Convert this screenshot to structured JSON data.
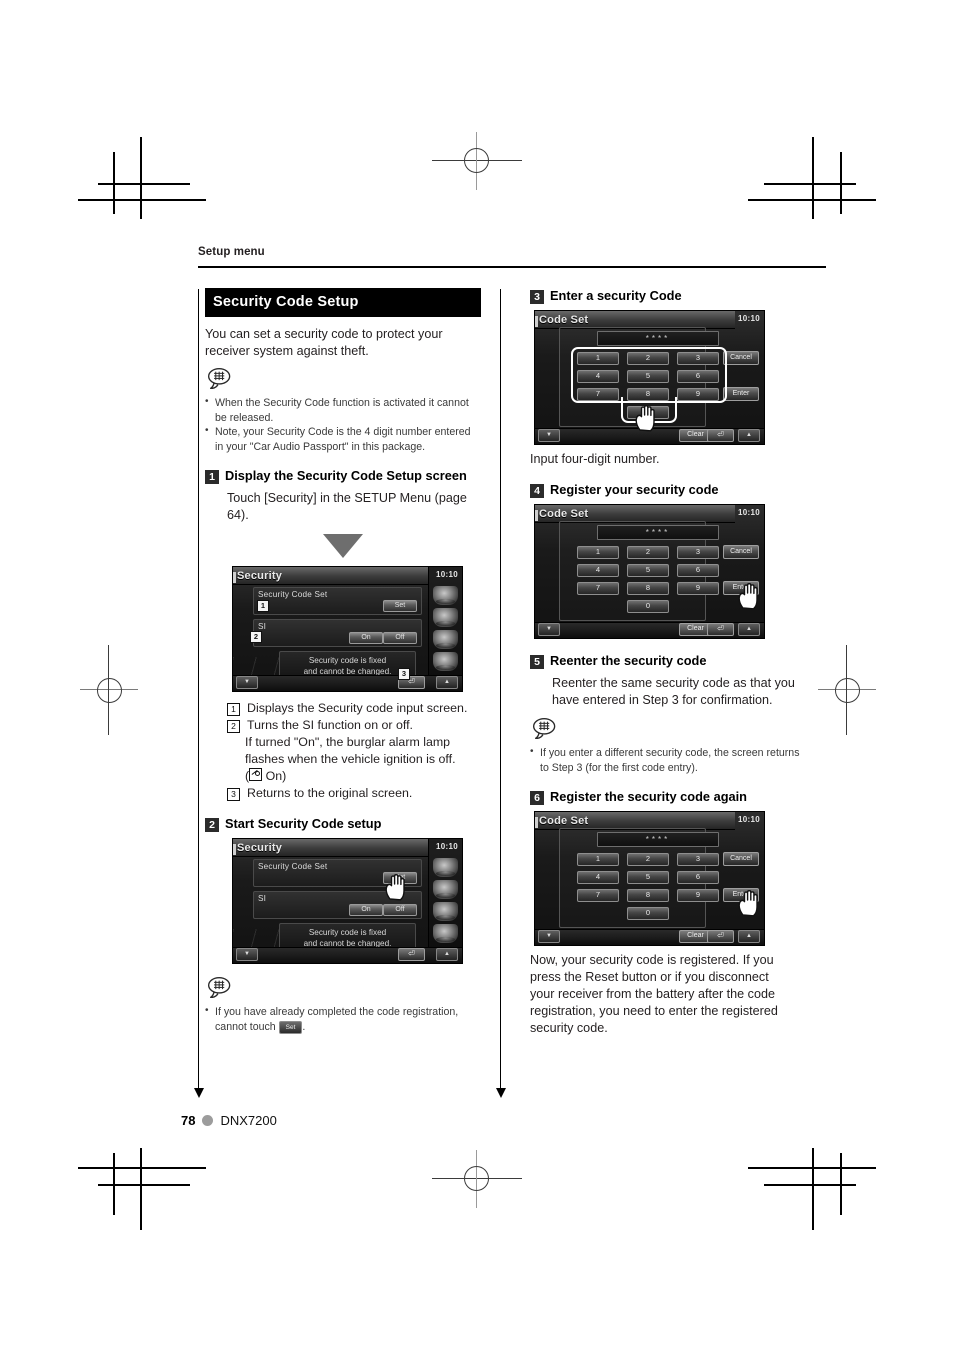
{
  "document": {
    "running_head": "Setup menu",
    "page_number": "78",
    "model": "DNX7200"
  },
  "section": {
    "title": "Security Code Setup",
    "intro": "You can set a security code to protect your receiver system against theft.",
    "note_icon": "note-bubble-icon",
    "notes": [
      "When the Security Code function is activated it cannot be released.",
      "Note, your Security Code is the 4 digit number entered in your \"Car Audio Passport\" in this package."
    ]
  },
  "steps": [
    {
      "num": "1",
      "title": "Display the Security Code Setup screen",
      "body": "Touch [Security] in the SETUP Menu (page 64)."
    },
    {
      "num": "2",
      "title": "Start Security Code setup"
    },
    {
      "num": "3",
      "title": "Enter a security Code",
      "body": "Input four-digit number."
    },
    {
      "num": "4",
      "title": "Register your security code"
    },
    {
      "num": "5",
      "title": "Reenter the security code",
      "body": "Reenter the same security code as that you have entered in Step 3 for confirmation."
    },
    {
      "num": "6",
      "title": "Register the security code again",
      "body": "Now, your security code is registered. If you press the Reset button or if you disconnect your receiver from the battery after the code registration, you need to enter the registered security code."
    }
  ],
  "callouts": [
    {
      "num": "1",
      "text": "Displays the Security code input screen."
    },
    {
      "num": "2",
      "text": "Turns the SI function on or off.",
      "cont1": "If turned \"On\", the burglar alarm lamp",
      "cont2": "flashes when the vehicle ignition is off.",
      "cont3_prefix": "(",
      "cont3_suffix": " On)"
    },
    {
      "num": "3",
      "text": "Returns to the original screen."
    }
  ],
  "notes_step2": {
    "icon": "note-bubble-icon",
    "prefix": "If you have already completed the code registration,",
    "line2_prefix": "cannot touch",
    "chip": "Set",
    "line2_suffix": "."
  },
  "notes_step5": {
    "icon": "note-bubble-icon",
    "line1": "If you enter a different security code, the screen returns",
    "line2": "to Step 3 (for the first code entry)."
  },
  "device_security": {
    "title": "Security",
    "clock": "10:10",
    "row1_label": "Security Code Set",
    "row1_button": "Set",
    "row2_label": "SI",
    "row2_on": "On",
    "row2_off": "Off",
    "info_line1": "Security code is fixed",
    "info_line2": "and cannot be changed.",
    "callout1": "1",
    "callout2": "2",
    "callout3": "3",
    "nav_left": "▼",
    "nav_right": "▲",
    "return_btn": "⏎"
  },
  "device_code": {
    "title": "Code Set",
    "clock": "10:10",
    "field_value": "****",
    "keys": [
      "1",
      "2",
      "3",
      "4",
      "5",
      "6",
      "7",
      "8",
      "9",
      "0"
    ],
    "cancel": "Cancel",
    "enter": "Enter",
    "clear": "Clear",
    "nav_left": "▼",
    "nav_right": "▲",
    "return_btn": "⏎"
  },
  "colors": {
    "section_bar_bg": "#000000",
    "section_bar_text": "#ffffff",
    "step_badge_bg": "#2b2b2b",
    "body_text": "#231f20",
    "note_text": "#3a3a3a",
    "triangle": "#6e6e6e",
    "footer_dot": "#9c9c9c"
  }
}
